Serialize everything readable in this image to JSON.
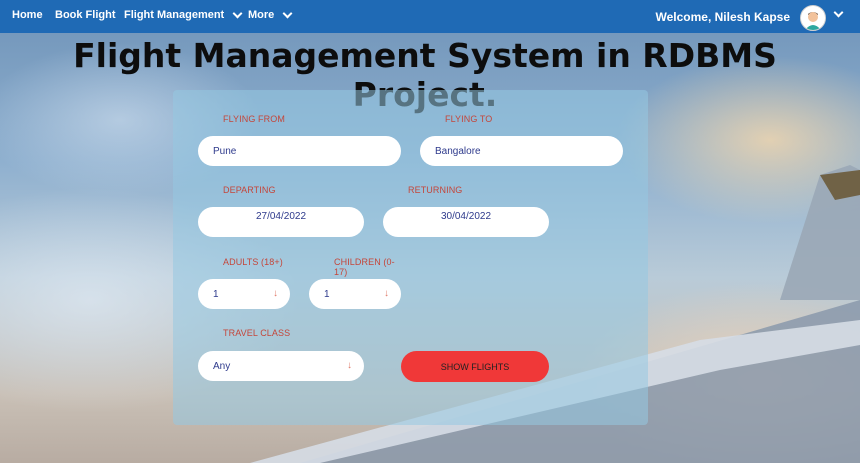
{
  "navbar": {
    "home": "Home",
    "book_flight": "Book Flight",
    "flight_management": "Flight Management",
    "more": "More",
    "welcome": "Welcome, Nilesh Kapse",
    "bg_color": "#1f6ab5"
  },
  "banner": {
    "title": "Flight Management System in RDBMS Project."
  },
  "form": {
    "flying_from_label": "FLYING FROM",
    "flying_from_value": "Pune",
    "flying_to_label": "FLYING TO",
    "flying_to_value": "Bangalore",
    "departing_label": "DEPARTING",
    "departing_value": "27/04/2022",
    "returning_label": "RETURNING",
    "returning_value": "30/04/2022",
    "adults_label": "ADULTS (18+)",
    "adults_value": "1",
    "children_label": "CHILDREN (0-17)",
    "children_value": "1",
    "travel_class_label": "TRAVEL CLASS",
    "travel_class_value": "Any",
    "submit_label": "SHOW FLIGHTS",
    "label_color": "#c4463a",
    "button_color": "#f03838"
  }
}
